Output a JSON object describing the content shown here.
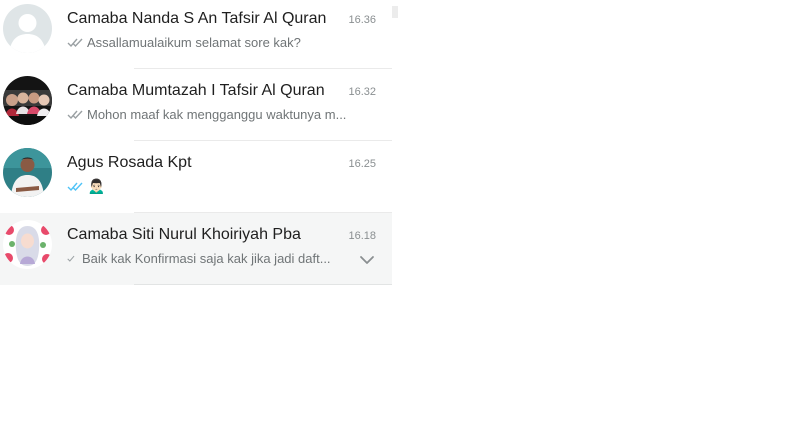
{
  "chats": [
    {
      "name": "Camaba Nanda S An Tafsir Al Quran",
      "time": "16.36",
      "preview": "Assallamualaikum selamat sore kak?",
      "status_icon": "double-check-icon",
      "status_color": "#9aa0a3",
      "avatar": "default-avatar-icon",
      "active": false
    },
    {
      "name": "Camaba Mumtazah I Tafsir Al Quran",
      "time": "16.32",
      "preview": "Mohon maaf kak mengganggu waktunya m...",
      "status_icon": "double-check-icon",
      "status_color": "#9aa0a3",
      "avatar": "group-photo-avatar",
      "active": false
    },
    {
      "name": "Agus Rosada Kpt",
      "time": "16.25",
      "preview": "🙍🏻‍♂️",
      "status_icon": "double-check-read-icon",
      "status_color": "#4fc3f7",
      "avatar": "man-photo-avatar",
      "active": false
    },
    {
      "name": "Camaba Siti Nurul Khoiriyah Pba",
      "time": "16.18",
      "preview": "Baik kak Konfirmasi saja kak jika jadi daft...",
      "status_icon": "single-check-icon",
      "status_color": "#9aa0a3",
      "avatar": "hijab-illustration-avatar",
      "active": true
    }
  ],
  "colors": {
    "active_row_bg": "#f5f6f6",
    "read_tick": "#4fc3f7",
    "sent_tick": "#9aa0a3"
  }
}
